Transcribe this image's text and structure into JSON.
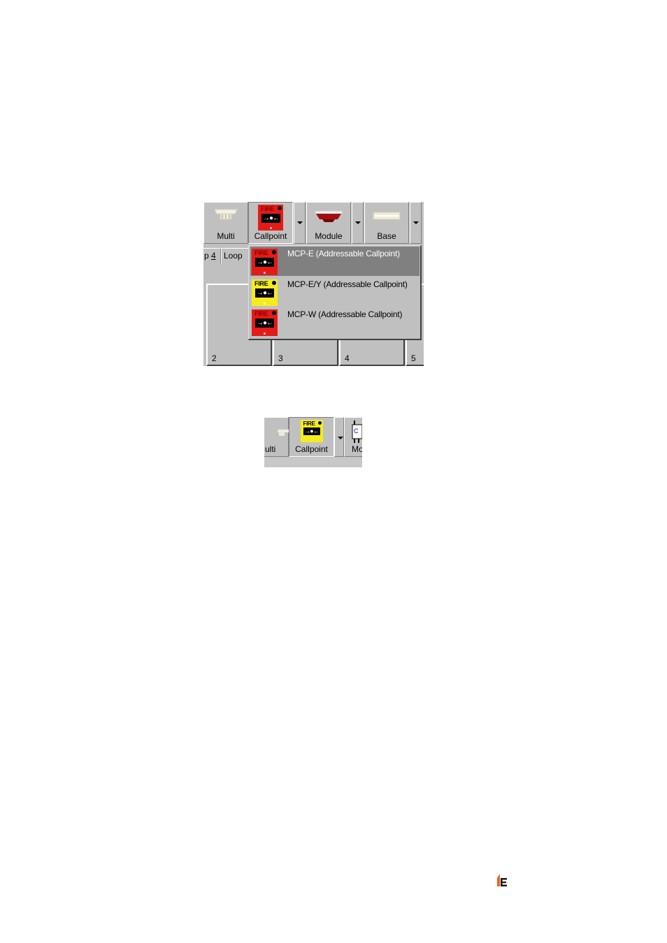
{
  "shot1": {
    "toolbar": [
      {
        "label": "Multi",
        "icon": "smoke-detector-icon"
      },
      {
        "label": "Callpoint",
        "icon": "fire-callpoint-red-icon"
      },
      {
        "label": "Module",
        "icon": "sounder-icon"
      },
      {
        "label": "Base",
        "icon": "base-icon"
      }
    ],
    "tabs": {
      "tab_a_prefix": "p ",
      "tab_a_num": "4",
      "tab_b": "Loop"
    },
    "cells": [
      "2",
      "3",
      "4",
      "5"
    ],
    "menu": [
      {
        "label": "MCP-E (Addressable Callpoint)",
        "icon_color": "red",
        "highlighted": true
      },
      {
        "label": "MCP-E/Y (Addressable Callpoint)",
        "icon_color": "yellow",
        "highlighted": false
      },
      {
        "label": "MCP-W (Addressable Callpoint)",
        "icon_color": "red",
        "highlighted": false
      }
    ]
  },
  "shot2": {
    "left_label": "ulti",
    "callpoint_label": "Callpoint",
    "right_label": "Mo",
    "right_icon_text": "C"
  },
  "fire_text": "FIRE",
  "arrows_text": "→●←",
  "colors": {
    "window_grey": "#c0c0c0",
    "highlight": "#808080",
    "fire_red": "#e41b17",
    "fire_yellow": "#f6ec1c",
    "logo_orange": "#e8641c"
  }
}
